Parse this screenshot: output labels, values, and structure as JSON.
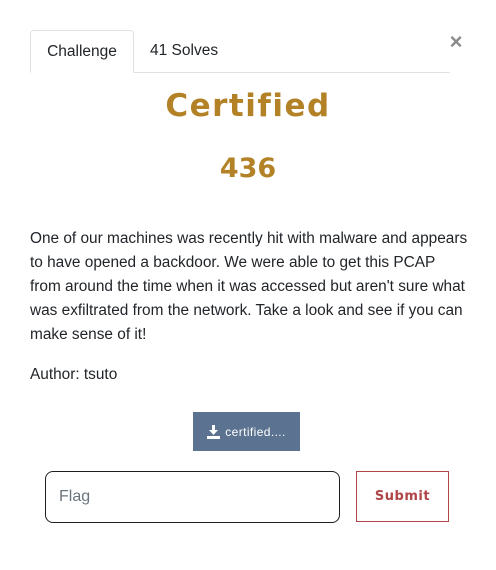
{
  "modal": {
    "close_glyph": "×",
    "tabs": [
      {
        "label": "Challenge",
        "active": true
      },
      {
        "label": "41 Solves",
        "active": false
      }
    ],
    "challenge": {
      "title": "Certified",
      "points": "436",
      "description": "One of our machines was recently hit with malware and appears to have opened a backdoor. We were able to get this PCAP from around the time when it was accessed but aren't sure what was exfiltrated from the network. Take a look and see if you can make sense of it!",
      "author": "Author: tsuto",
      "file_label": "certified...."
    },
    "form": {
      "flag_placeholder": "Flag",
      "flag_value": "",
      "submit_label": "Submit"
    }
  },
  "colors": {
    "accent_gold": "#b38227",
    "file_button_bg": "#5b7290",
    "submit_red": "#b04547"
  },
  "icons": {
    "close": "close-icon",
    "download": "download-icon"
  }
}
